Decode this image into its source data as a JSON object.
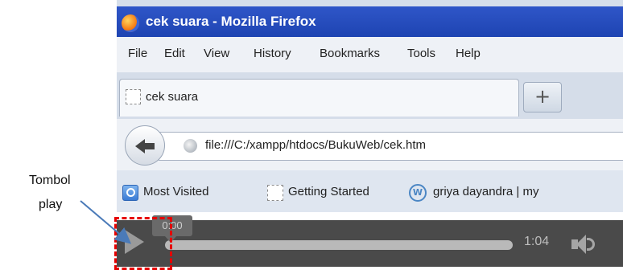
{
  "annotation": {
    "label_line1": "Tombol",
    "label_line2": "play",
    "highlight_color": "#e60000"
  },
  "window": {
    "title": "cek suara - Mozilla Firefox",
    "icon": "firefox-logo-icon"
  },
  "menu": {
    "items": [
      "File",
      "Edit",
      "View",
      "History",
      "Bookmarks",
      "Tools",
      "Help"
    ]
  },
  "tabs": [
    {
      "label": "cek suara",
      "icon": "page-icon"
    }
  ],
  "new_tab_label": "+",
  "navigation": {
    "back_icon": "back-arrow-icon",
    "url": "file:///C:/xampp/htdocs/BukuWeb/cek.htm"
  },
  "bookmarks": {
    "items": [
      {
        "label": "Most Visited",
        "icon": "most-visited-icon"
      },
      {
        "label": "Getting Started",
        "icon": "page-icon"
      },
      {
        "label": "griya dayandra | my",
        "icon": "wordpress-icon"
      }
    ]
  },
  "player": {
    "current_time": "0:00",
    "duration": "1:04",
    "progress": 0,
    "play_icon": "play-icon",
    "volume_icon": "volume-icon"
  }
}
